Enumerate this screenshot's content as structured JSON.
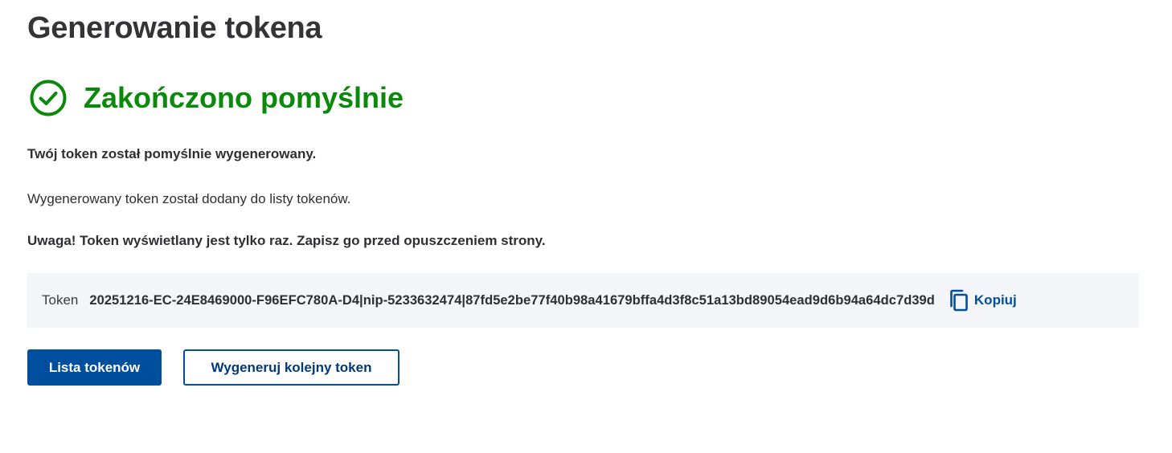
{
  "page": {
    "title": "Generowanie tokena"
  },
  "status": {
    "icon": "check-circle-icon",
    "text": "Zakończono pomyślnie",
    "color": "#0a8a0a"
  },
  "messages": {
    "success": "Twój token został pomyślnie wygenerowany.",
    "info": "Wygenerowany token został dodany do listy tokenów.",
    "warning": "Uwaga! Token wyświetlany jest tylko raz. Zapisz go przed opuszczeniem strony."
  },
  "token": {
    "label": "Token",
    "value": "20251216-EC-24E8469000-F96EFC780A-D4|nip-5233632474|87fd5e2be77f40b98a41679bffa4d3f8c51a13bd89054ead9d6b94a64dc7d39d",
    "copy_icon": "copy-icon",
    "copy_label": "Kopiuj"
  },
  "actions": {
    "primary_label": "Lista tokenów",
    "secondary_label": "Wygeneruj kolejny token",
    "accent_color": "#004e9e"
  }
}
